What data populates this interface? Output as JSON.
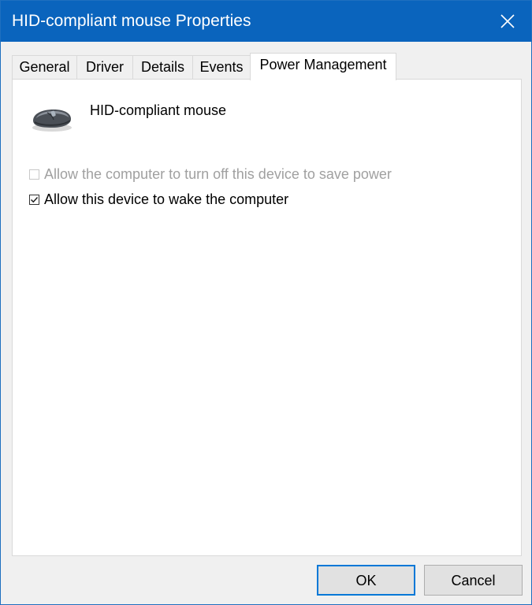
{
  "window": {
    "title": "HID-compliant mouse Properties",
    "accent_color": "#0a64bd"
  },
  "titlebar": {
    "close_icon": "close-icon"
  },
  "tabs": [
    {
      "label": "General",
      "active": false
    },
    {
      "label": "Driver",
      "active": false
    },
    {
      "label": "Details",
      "active": false
    },
    {
      "label": "Events",
      "active": false
    },
    {
      "label": "Power Management",
      "active": true
    }
  ],
  "panel": {
    "device_icon": "mouse-icon",
    "device_name": "HID-compliant mouse",
    "options": [
      {
        "label": "Allow the computer to turn off this device to save power",
        "checked": false,
        "enabled": false
      },
      {
        "label": "Allow this device to wake the computer",
        "checked": true,
        "enabled": true
      }
    ]
  },
  "buttons": {
    "ok_label": "OK",
    "cancel_label": "Cancel"
  }
}
